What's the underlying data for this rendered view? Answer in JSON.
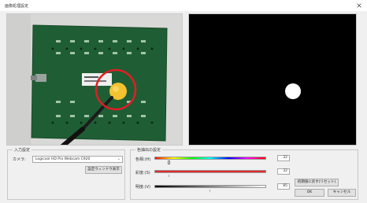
{
  "window": {
    "title": "画像処理設定"
  },
  "camera_group": {
    "legend": "入力設定",
    "camera_label": "カメラ:",
    "camera_value": "Logicool HD Pro Webcam C920",
    "settings_button": "設定ウィンドウ表示"
  },
  "hsv_group": {
    "legend": "色抽出の設定",
    "sliders": [
      {
        "label": "色相:(H)",
        "value": "32",
        "level": 0.12,
        "thumb": "knob"
      },
      {
        "label": "彩度:(S)",
        "value": "32",
        "level": 0.12,
        "thumb": "tick"
      },
      {
        "label": "明度:(V)",
        "value": "85",
        "level": 0.5,
        "thumb": "tick"
      }
    ]
  },
  "buttons": {
    "reset": "初期値に戻す(リセット)",
    "ok": "OK",
    "cancel": "キャンセル"
  },
  "camera_view": {
    "highlight_color": "#e01e24",
    "object_color": "#f2c230",
    "board_color": "#1f5e34"
  },
  "mask_view": {
    "background": "#000000",
    "blob_color": "#ffffff"
  }
}
